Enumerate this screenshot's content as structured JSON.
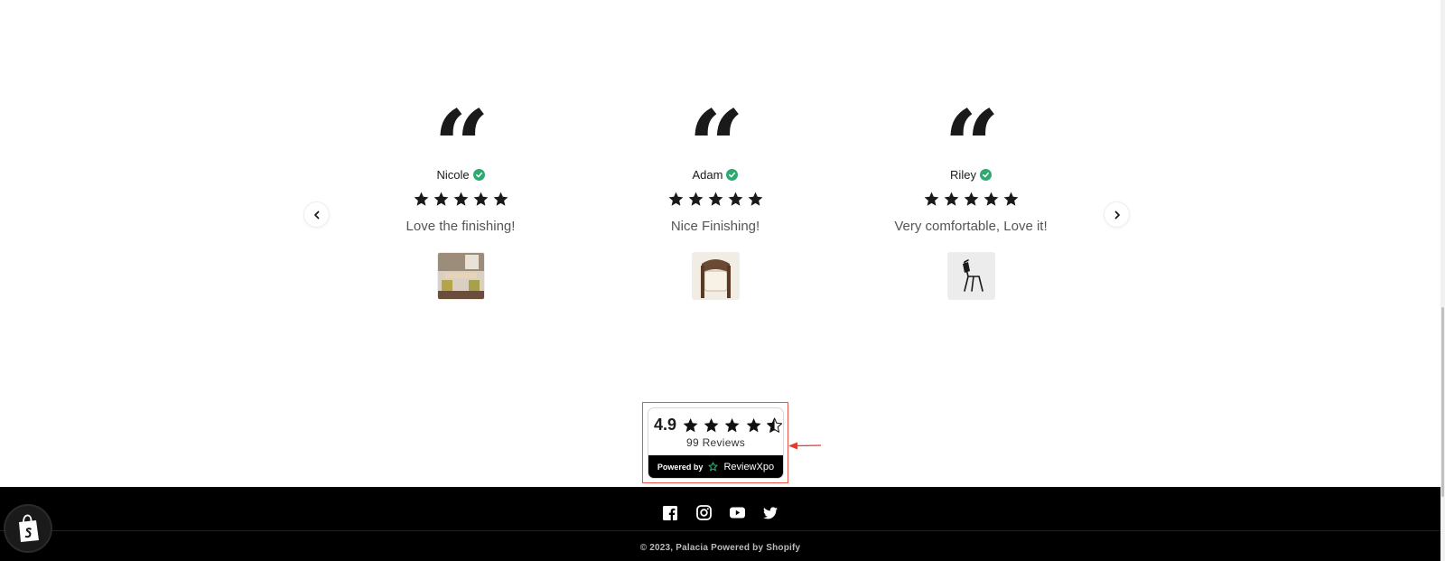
{
  "reviews": [
    {
      "quote_glyph": "“",
      "name": "Nicole",
      "rating": 5,
      "text": "Love the finishing!",
      "thumb": "dining-table-with-chairs-photo"
    },
    {
      "quote_glyph": "“",
      "name": "Adam",
      "rating": 5,
      "text": "Nice Finishing!",
      "thumb": "wooden-chair-photo"
    },
    {
      "quote_glyph": "“",
      "name": "Riley",
      "rating": 5,
      "text": "Very comfortable, Love it!",
      "thumb": "black-metal-chair-photo"
    }
  ],
  "carousel": {
    "prev_icon": "chevron-left-icon",
    "next_icon": "chevron-right-icon"
  },
  "badge": {
    "score": "4.9",
    "rating": 4.5,
    "count_label": "99 Reviews",
    "powered_label": "Powered by",
    "brand": "ReviewXpo"
  },
  "footer": {
    "social": [
      "facebook-icon",
      "instagram-icon",
      "youtube-icon",
      "twitter-icon"
    ],
    "copyright": "© 2023, Palacia Powered by Shopify"
  },
  "colors": {
    "accent_verified": "#2eaa71",
    "highlight": "#e8564a",
    "footer_bg": "#000000"
  }
}
